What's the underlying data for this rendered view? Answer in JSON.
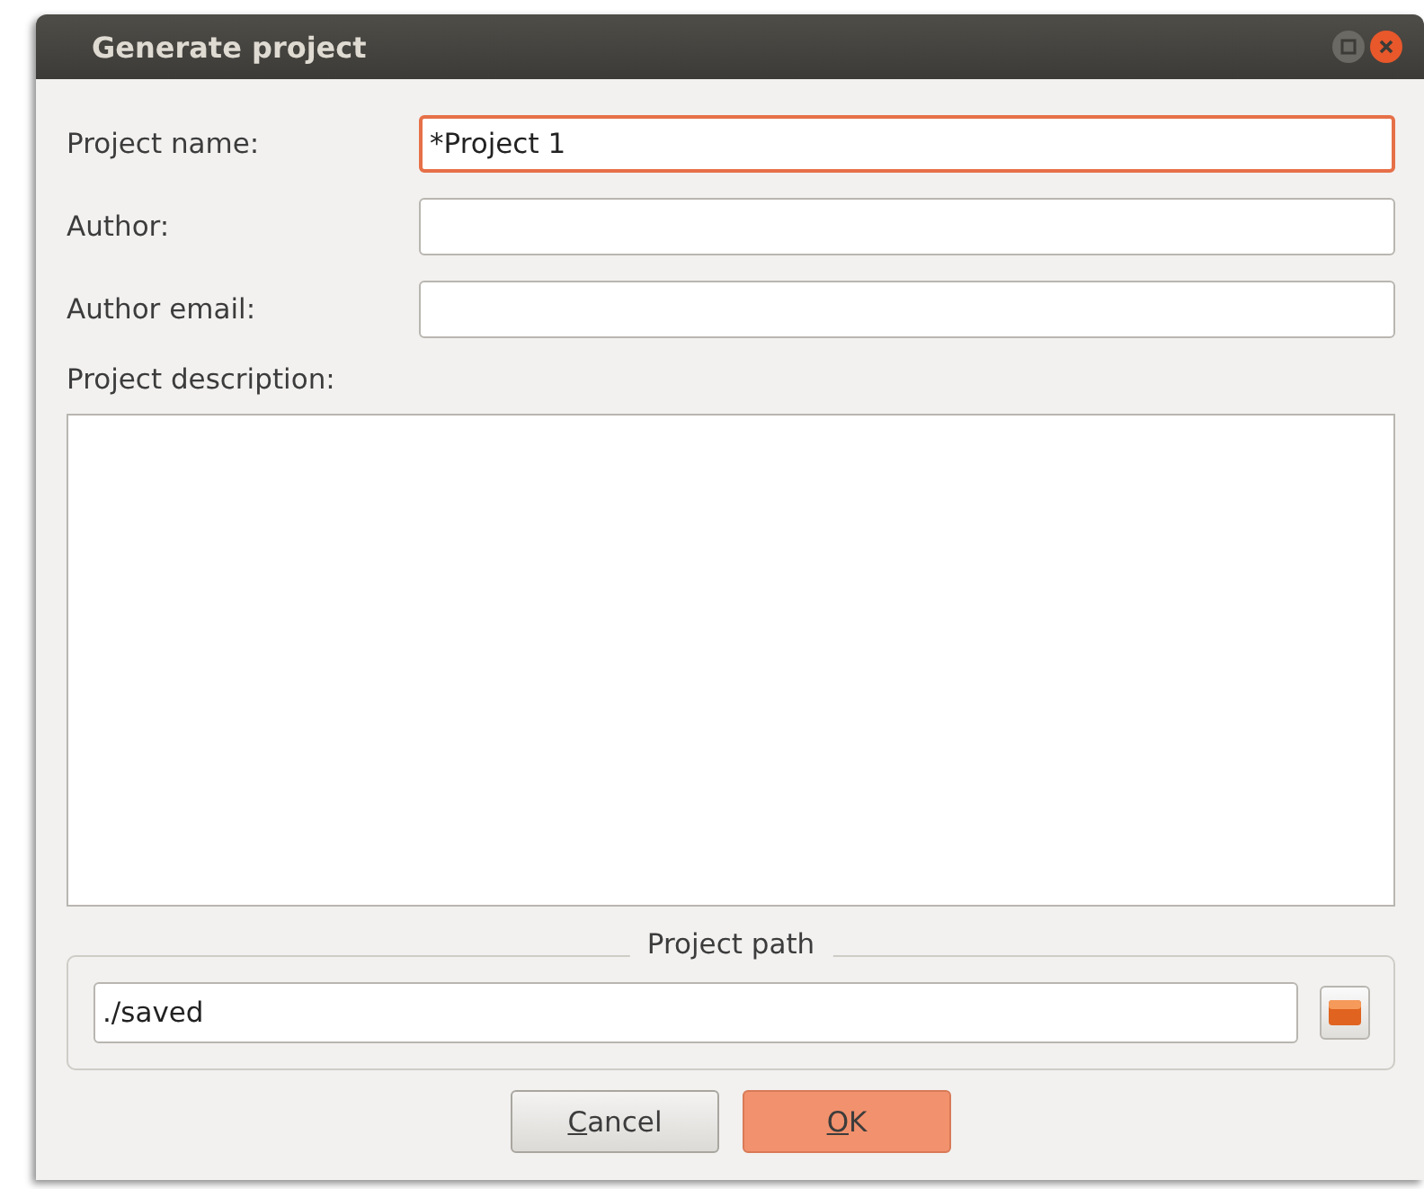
{
  "window": {
    "title": "Generate project"
  },
  "fields": [
    {
      "label": "Project name:",
      "value": "*Project 1",
      "focused": true
    },
    {
      "label": "Author:",
      "focused": false
    },
    {
      "label": "Author email:",
      "focused": false
    }
  ],
  "description": {
    "label": "Project description:"
  },
  "project_path": {
    "legend": "Project path",
    "value": "./saved"
  },
  "buttons": [
    {
      "label": "Cancel",
      "default": false,
      "underline_first": true
    },
    {
      "label": "OK",
      "default": true,
      "underline_first": true
    }
  ]
}
